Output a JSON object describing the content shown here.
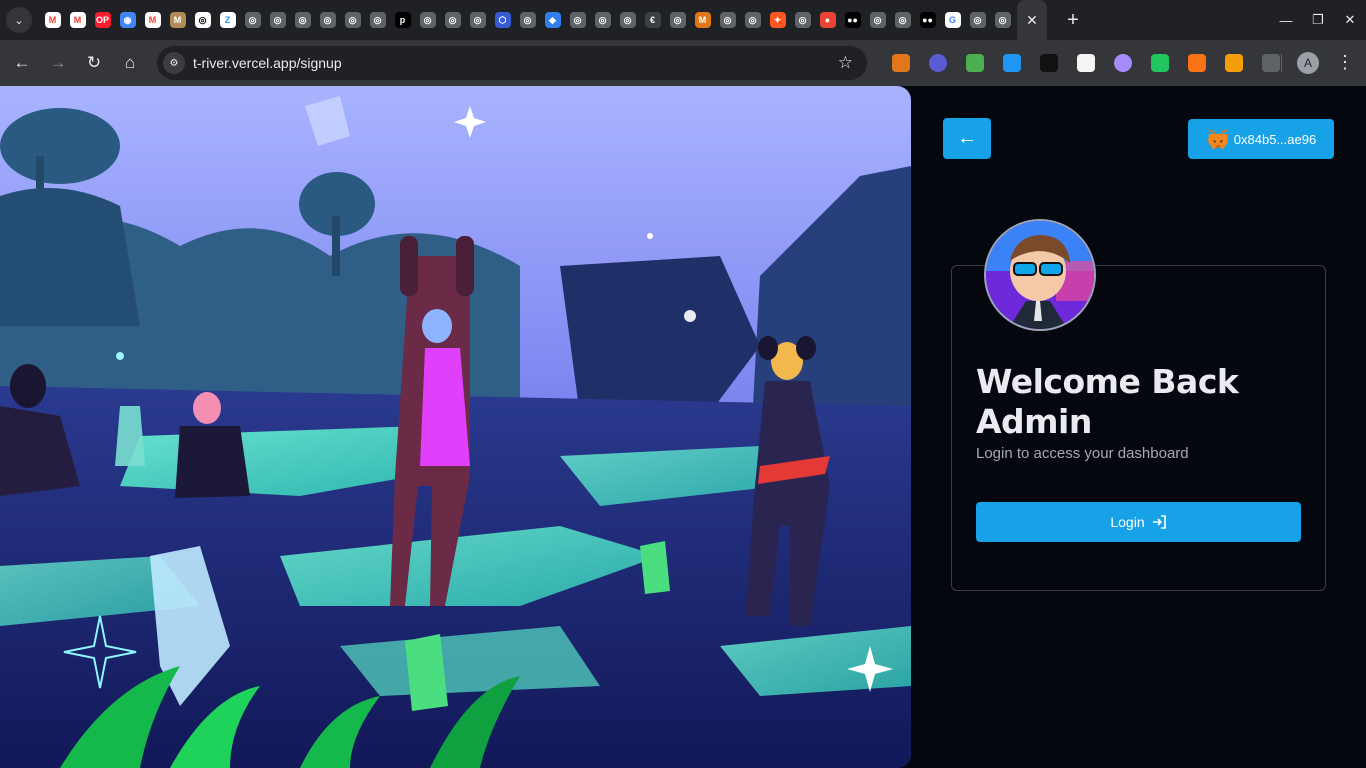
{
  "browser": {
    "tab_icons": [
      "gmail-icon",
      "gmail-icon",
      "opera-icon",
      "globe-icon",
      "gmail-icon",
      "coin-icon",
      "github-icon",
      "zoom-icon",
      "app-icon",
      "app-icon",
      "app-icon",
      "app-icon",
      "app-icon",
      "app-icon",
      "p-icon",
      "app-icon",
      "app-icon",
      "app-icon",
      "chain-icon",
      "app-icon",
      "drop-icon",
      "app-icon",
      "app-icon",
      "app-icon",
      "euro-icon",
      "app-icon",
      "metamask-icon",
      "app-icon",
      "app-icon",
      "star-icon",
      "app-icon",
      "record-icon",
      "medium-icon",
      "app-icon",
      "app-icon",
      "medium-icon",
      "google-icon",
      "app-icon",
      "app-icon"
    ],
    "active_tab_close": "✕",
    "new_tab": "+",
    "url": "t-river.vercel.app/signup",
    "profile_initial": "A"
  },
  "page": {
    "back_arrow": "←",
    "wallet_address": "0x84b5...ae96",
    "welcome_line1": "Welcome Back",
    "welcome_line2": "Admin",
    "subtitle": "Login to access your dashboard",
    "login_label": "Login"
  },
  "colors": {
    "accent": "#17a1e6",
    "background": "#05070f",
    "card_border": "#3a3f4b"
  }
}
